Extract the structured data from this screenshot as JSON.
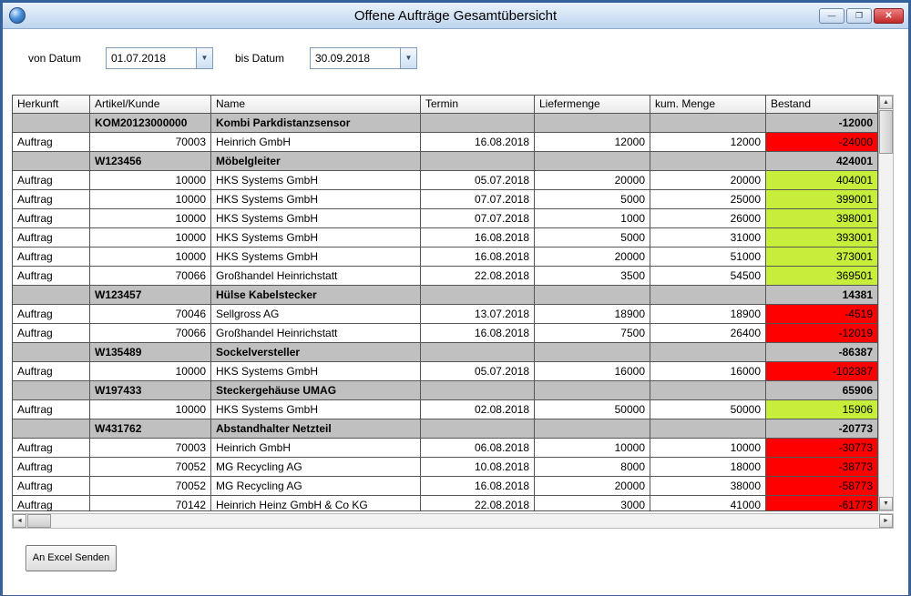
{
  "window": {
    "title": "Offene Aufträge Gesamtübersicht"
  },
  "icons": {
    "minimize": "—",
    "maximize": "❐",
    "close": "✕",
    "dropdown": "▼",
    "scroll_up": "▲",
    "scroll_down": "▼",
    "scroll_left": "◄",
    "scroll_right": "►"
  },
  "filters": {
    "from_label": "von Datum",
    "from_value": "01.07.2018",
    "to_label": "bis Datum",
    "to_value": "30.09.2018"
  },
  "colors": {
    "bestand_negative_bg": "#ff0000",
    "bestand_positive_bg": "#c6ee3a",
    "group_row_bg": "#c0c0c0"
  },
  "table": {
    "columns": [
      "Herkunft",
      "Artikel/Kunde",
      "Name",
      "Termin",
      "Liefermenge",
      "kum. Menge",
      "Bestand"
    ],
    "rows": [
      {
        "type": "group",
        "herkunft": "",
        "artikel_kunde": "KOM20123000000",
        "name": "Kombi Parkdistanzsensor",
        "termin": "",
        "liefermenge": "",
        "kum_menge": "",
        "bestand": "-12000"
      },
      {
        "type": "detail",
        "herkunft": "Auftrag",
        "artikel_kunde": "70003",
        "name": "Heinrich GmbH",
        "termin": "16.08.2018",
        "liefermenge": "12000",
        "kum_menge": "12000",
        "bestand": "-24000",
        "bestand_color": "negative"
      },
      {
        "type": "group",
        "herkunft": "",
        "artikel_kunde": "W123456",
        "name": "Möbelgleiter",
        "termin": "",
        "liefermenge": "",
        "kum_menge": "",
        "bestand": "424001"
      },
      {
        "type": "detail",
        "herkunft": "Auftrag",
        "artikel_kunde": "10000",
        "name": "HKS Systems GmbH",
        "termin": "05.07.2018",
        "liefermenge": "20000",
        "kum_menge": "20000",
        "bestand": "404001",
        "bestand_color": "positive"
      },
      {
        "type": "detail",
        "herkunft": "Auftrag",
        "artikel_kunde": "10000",
        "name": "HKS Systems GmbH",
        "termin": "07.07.2018",
        "liefermenge": "5000",
        "kum_menge": "25000",
        "bestand": "399001",
        "bestand_color": "positive"
      },
      {
        "type": "detail",
        "herkunft": "Auftrag",
        "artikel_kunde": "10000",
        "name": "HKS Systems GmbH",
        "termin": "07.07.2018",
        "liefermenge": "1000",
        "kum_menge": "26000",
        "bestand": "398001",
        "bestand_color": "positive"
      },
      {
        "type": "detail",
        "herkunft": "Auftrag",
        "artikel_kunde": "10000",
        "name": "HKS Systems GmbH",
        "termin": "16.08.2018",
        "liefermenge": "5000",
        "kum_menge": "31000",
        "bestand": "393001",
        "bestand_color": "positive"
      },
      {
        "type": "detail",
        "herkunft": "Auftrag",
        "artikel_kunde": "10000",
        "name": "HKS Systems GmbH",
        "termin": "16.08.2018",
        "liefermenge": "20000",
        "kum_menge": "51000",
        "bestand": "373001",
        "bestand_color": "positive"
      },
      {
        "type": "detail",
        "herkunft": "Auftrag",
        "artikel_kunde": "70066",
        "name": "Großhandel Heinrichstatt",
        "termin": "22.08.2018",
        "liefermenge": "3500",
        "kum_menge": "54500",
        "bestand": "369501",
        "bestand_color": "positive"
      },
      {
        "type": "group",
        "herkunft": "",
        "artikel_kunde": "W123457",
        "name": "Hülse Kabelstecker",
        "termin": "",
        "liefermenge": "",
        "kum_menge": "",
        "bestand": "14381"
      },
      {
        "type": "detail",
        "herkunft": "Auftrag",
        "artikel_kunde": "70046",
        "name": "Sellgross AG",
        "termin": "13.07.2018",
        "liefermenge": "18900",
        "kum_menge": "18900",
        "bestand": "-4519",
        "bestand_color": "negative"
      },
      {
        "type": "detail",
        "herkunft": "Auftrag",
        "artikel_kunde": "70066",
        "name": "Großhandel Heinrichstatt",
        "termin": "16.08.2018",
        "liefermenge": "7500",
        "kum_menge": "26400",
        "bestand": "-12019",
        "bestand_color": "negative"
      },
      {
        "type": "group",
        "herkunft": "",
        "artikel_kunde": "W135489",
        "name": "Sockelversteller",
        "termin": "",
        "liefermenge": "",
        "kum_menge": "",
        "bestand": "-86387"
      },
      {
        "type": "detail",
        "herkunft": "Auftrag",
        "artikel_kunde": "10000",
        "name": "HKS Systems GmbH",
        "termin": "05.07.2018",
        "liefermenge": "16000",
        "kum_menge": "16000",
        "bestand": "-102387",
        "bestand_color": "negative"
      },
      {
        "type": "group",
        "herkunft": "",
        "artikel_kunde": "W197433",
        "name": "Steckergehäuse UMAG",
        "termin": "",
        "liefermenge": "",
        "kum_menge": "",
        "bestand": "65906"
      },
      {
        "type": "detail",
        "herkunft": "Auftrag",
        "artikel_kunde": "10000",
        "name": "HKS Systems GmbH",
        "termin": "02.08.2018",
        "liefermenge": "50000",
        "kum_menge": "50000",
        "bestand": "15906",
        "bestand_color": "positive"
      },
      {
        "type": "group",
        "herkunft": "",
        "artikel_kunde": "W431762",
        "name": "Abstandhalter Netzteil",
        "termin": "",
        "liefermenge": "",
        "kum_menge": "",
        "bestand": "-20773"
      },
      {
        "type": "detail",
        "herkunft": "Auftrag",
        "artikel_kunde": "70003",
        "name": "Heinrich GmbH",
        "termin": "06.08.2018",
        "liefermenge": "10000",
        "kum_menge": "10000",
        "bestand": "-30773",
        "bestand_color": "negative"
      },
      {
        "type": "detail",
        "herkunft": "Auftrag",
        "artikel_kunde": "70052",
        "name": "MG Recycling AG",
        "termin": "10.08.2018",
        "liefermenge": "8000",
        "kum_menge": "18000",
        "bestand": "-38773",
        "bestand_color": "negative"
      },
      {
        "type": "detail",
        "herkunft": "Auftrag",
        "artikel_kunde": "70052",
        "name": "MG Recycling AG",
        "termin": "16.08.2018",
        "liefermenge": "20000",
        "kum_menge": "38000",
        "bestand": "-58773",
        "bestand_color": "negative"
      },
      {
        "type": "detail",
        "herkunft": "Auftrag",
        "artikel_kunde": "70142",
        "name": "Heinrich Heinz GmbH & Co KG",
        "termin": "22.08.2018",
        "liefermenge": "3000",
        "kum_menge": "41000",
        "bestand": "-61773",
        "bestand_color": "negative"
      }
    ]
  },
  "footer": {
    "excel_button_label": "An Excel Senden"
  }
}
